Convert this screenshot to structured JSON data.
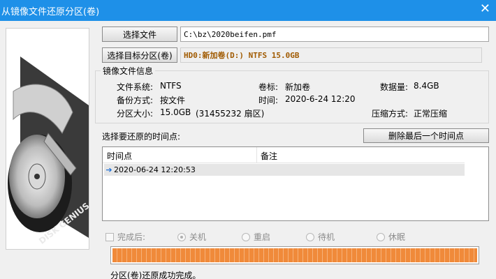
{
  "window": {
    "title": "从镜像文件还原分区(卷)",
    "close_glyph": "✕"
  },
  "source": {
    "button_label": "选择文件",
    "path": "C:\\bz\\2020beifen.pmf"
  },
  "target": {
    "button_label": "选择目标分区(卷)",
    "value": "HD0:新加卷(D:) NTFS 15.0GB"
  },
  "image_info": {
    "group_title": "镜像文件信息",
    "fs_label": "文件系统:",
    "fs_value": "NTFS",
    "volume_label": "卷标:",
    "volume_value": "新加卷",
    "data_label": "数据量:",
    "data_value": "8.4GB",
    "method_label": "备份方式:",
    "method_value": "按文件",
    "time_label": "时间:",
    "time_value": "2020-6-24 12:20",
    "size_label": "分区大小:",
    "size_value": "15.0GB",
    "sectors_value": "(31455232 扇区)",
    "compress_label": "压缩方式:",
    "compress_value": "正常压缩"
  },
  "restore_points": {
    "label": "选择要还原的时间点:",
    "delete_button": "删除最后一个时间点",
    "columns": [
      "时间点",
      "备注"
    ],
    "rows": [
      {
        "time": "2020-06-24 12:20:53",
        "note": ""
      }
    ]
  },
  "after_options": {
    "label": "完成后:",
    "choices": [
      "关机",
      "重启",
      "待机",
      "休眠"
    ],
    "selected": "关机"
  },
  "progress": {
    "percent": 100
  },
  "status_text": "分区(卷)还原成功完成。",
  "art": {
    "text": "DISK GENIUS"
  }
}
